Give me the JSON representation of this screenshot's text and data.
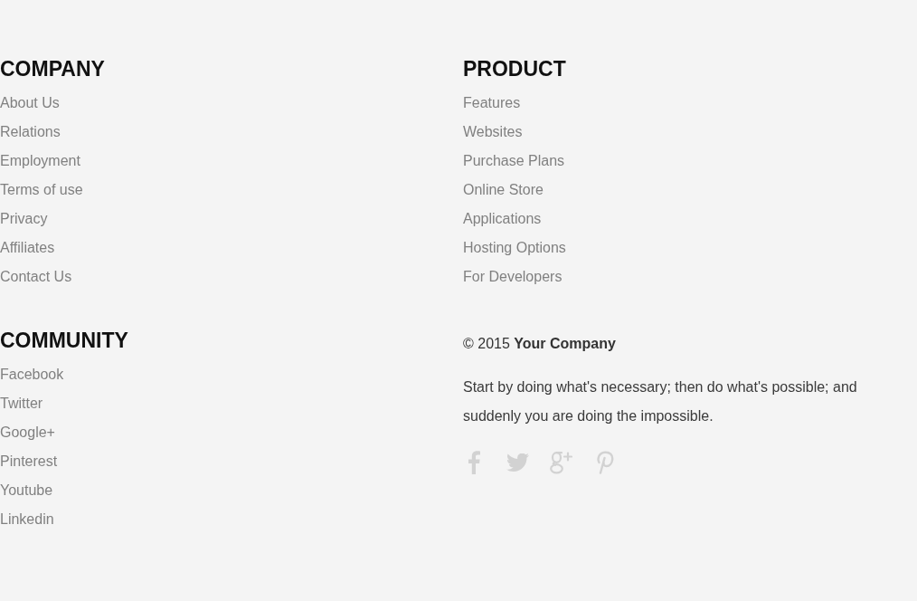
{
  "left_column": [
    {
      "heading": "COMPANY",
      "links": [
        "About Us",
        "Relations",
        "Employment",
        "Terms of use",
        "Privacy",
        "Affiliates",
        "Contact Us"
      ]
    },
    {
      "heading": "COMMUNITY",
      "links": [
        "Facebook",
        "Twitter",
        "Google+",
        "Pinterest",
        "Youtube",
        "Linkedin"
      ]
    }
  ],
  "right_column": {
    "section": {
      "heading": "PRODUCT",
      "links": [
        "Features",
        "Websites",
        "Purchase Plans",
        "Online Store",
        "Applications",
        "Hosting Options",
        "For Developers"
      ]
    },
    "copyright": "© 2015 **Your Company**",
    "quote": "Start by doing what's necessary; then do what's possible; and suddenly you are doing the impossible.",
    "social_icons": [
      {
        "kind": "facebook"
      },
      {
        "kind": "twitter"
      },
      {
        "kind": "googleplus"
      },
      {
        "kind": "pinterest"
      }
    ]
  }
}
